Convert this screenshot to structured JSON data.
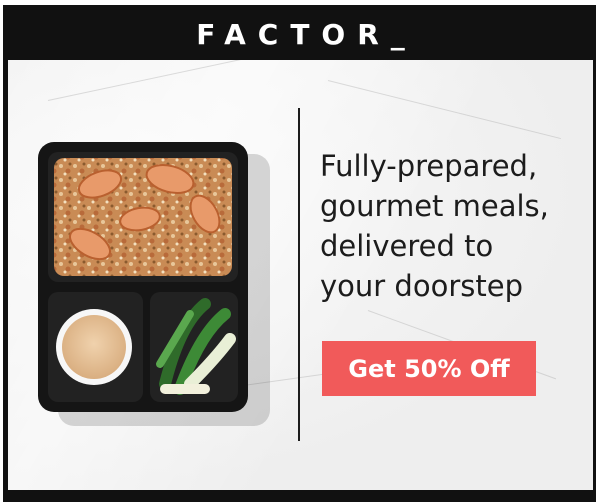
{
  "brand": {
    "logo_text": "FACTOR_"
  },
  "ad": {
    "tagline_lines": [
      "Fully-prepared,",
      "gourmet meals,",
      "delivered to",
      "your doorstep"
    ],
    "cta_label": "Get 50% Off"
  },
  "colors": {
    "header_bg": "#111111",
    "cta_bg": "#f15a5a",
    "text": "#1c1c1c"
  },
  "image": {
    "subject": "meal-tray-icon"
  }
}
